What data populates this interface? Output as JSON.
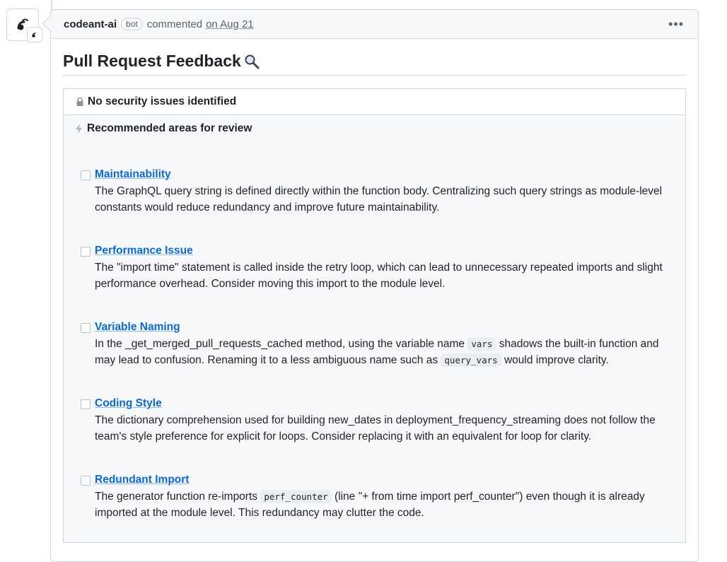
{
  "comment": {
    "author": "codeant-ai",
    "badge": "bot",
    "action": "commented",
    "date": "on Aug 21",
    "menu_icon": "kebab-horizontal-icon"
  },
  "title": "Pull Request Feedback",
  "title_icon": "magnifier-icon",
  "security": {
    "icon": "lock-icon",
    "text": "No security issues identified"
  },
  "review": {
    "icon": "lightning-icon",
    "title": "Recommended areas for review",
    "items": [
      {
        "label": "Maintainability",
        "text": "The GraphQL query string is defined directly within the function body. Centralizing such query strings as module-level constants would reduce redundancy and improve future maintainability."
      },
      {
        "label": "Performance Issue",
        "text": "The \"import time\" statement is called inside the retry loop, which can lead to unnecessary repeated imports and slight performance overhead. Consider moving this import to the module level."
      },
      {
        "label": "Variable Naming",
        "text_1": "In the _get_merged_pull_requests_cached method, using the variable name",
        "code_1": "vars",
        "text_2": "shadows the built-in function and may lead to confusion. Renaming it to a less ambiguous name such as",
        "code_2": "query_vars",
        "text_3": "would improve clarity."
      },
      {
        "label": "Coding Style",
        "text": "The dictionary comprehension used for building new_dates in deployment_frequency_streaming does not follow the team's style preference for explicit for loops. Consider replacing it with an equivalent for loop for clarity."
      },
      {
        "label": "Redundant Import",
        "text_1": "The generator function re-imports",
        "code_1": "perf_counter",
        "text_2": "(line \"+ from time import perf_counter\") even though it is already imported at the module level. This redundancy may clutter the code."
      }
    ]
  }
}
